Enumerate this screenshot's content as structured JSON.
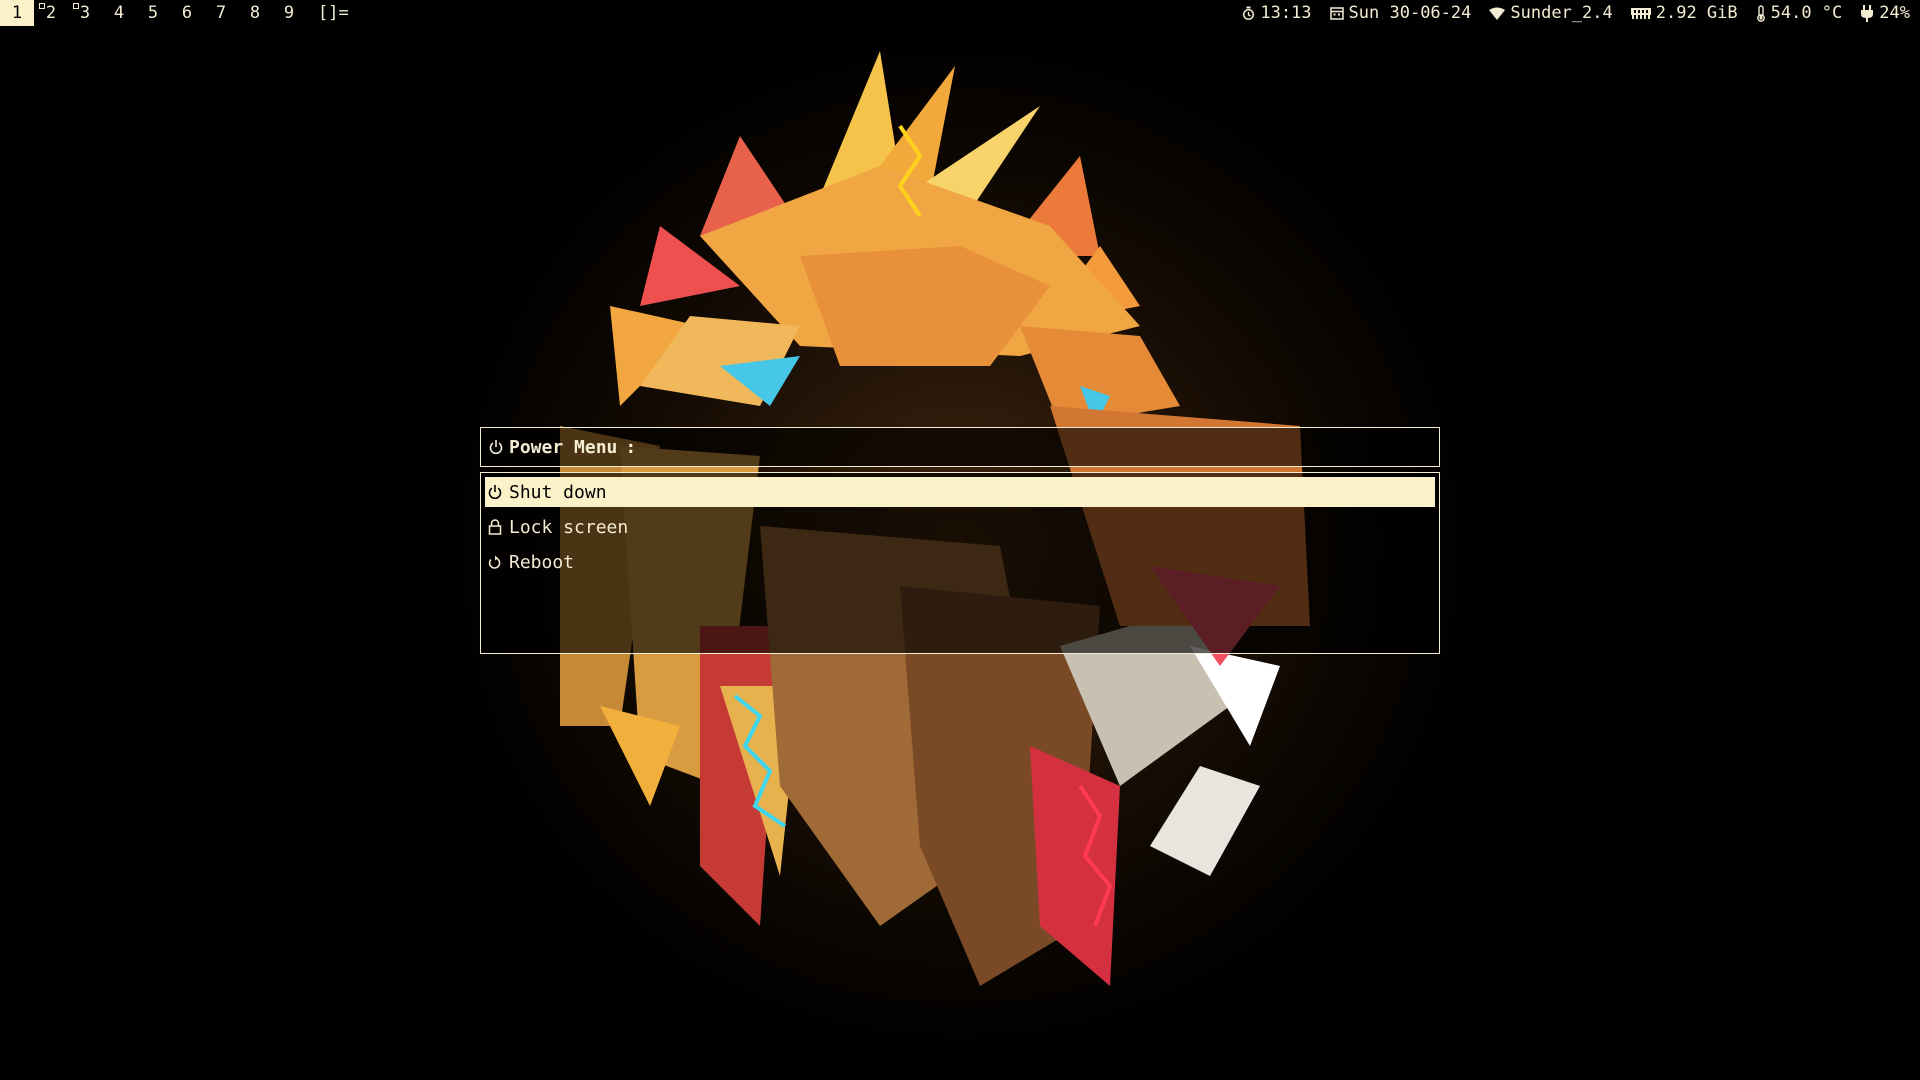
{
  "bar": {
    "tags": [
      {
        "label": "1",
        "active": true,
        "occupied": false
      },
      {
        "label": "2",
        "active": false,
        "occupied": true
      },
      {
        "label": "3",
        "active": false,
        "occupied": true
      },
      {
        "label": "4",
        "active": false,
        "occupied": false
      },
      {
        "label": "5",
        "active": false,
        "occupied": false
      },
      {
        "label": "6",
        "active": false,
        "occupied": false
      },
      {
        "label": "7",
        "active": false,
        "occupied": false
      },
      {
        "label": "8",
        "active": false,
        "occupied": false
      },
      {
        "label": "9",
        "active": false,
        "occupied": false
      }
    ],
    "layout_symbol": "[]=",
    "status": {
      "time": "13:13",
      "date": "Sun 30-06-24",
      "wifi": "Sunder_2.4",
      "memory": "2.92 GiB",
      "temperature": "54.0 °C",
      "battery": "24%"
    },
    "icons": {
      "time": "clock-icon",
      "date": "calendar-icon",
      "wifi": "wifi-icon",
      "memory": "memory-icon",
      "temperature": "thermometer-icon",
      "battery": "plug-icon"
    }
  },
  "menu": {
    "prompt_label": "Power Menu",
    "prompt_separator": ":",
    "prompt_icon": "power-icon",
    "items": [
      {
        "label": "Shut down",
        "icon": "power-icon",
        "selected": true
      },
      {
        "label": "Lock screen",
        "icon": "lock-icon",
        "selected": false
      },
      {
        "label": "Reboot",
        "icon": "reboot-icon",
        "selected": false
      }
    ]
  },
  "colors": {
    "foreground": "#f3ecd2",
    "selection_bg": "#fbf2c9",
    "background": "#000000"
  }
}
